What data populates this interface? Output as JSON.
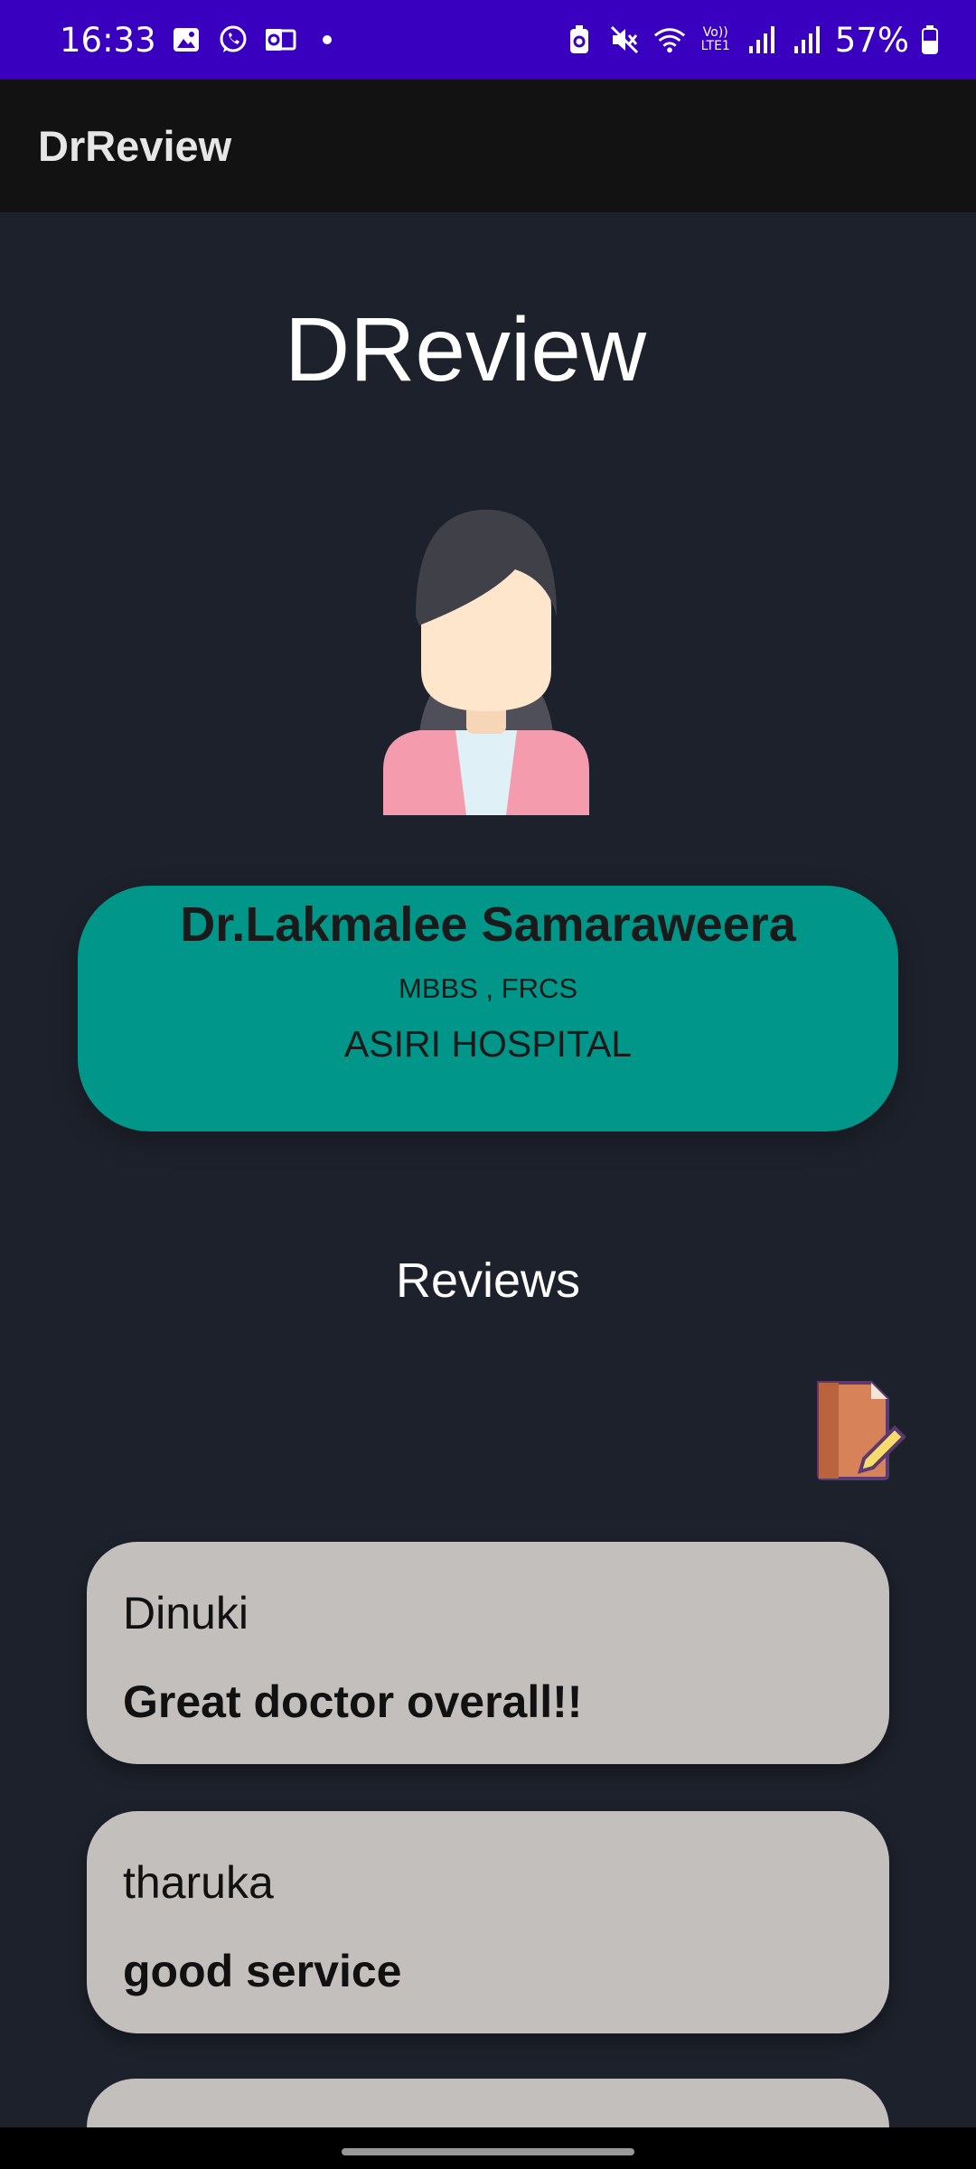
{
  "status_bar": {
    "time": "16:33",
    "battery": "57%",
    "icons_left": [
      "gallery-icon",
      "whatsapp-icon",
      "outlook-icon",
      "dot-icon"
    ],
    "icons_right": [
      "battery-saver-icon",
      "mute-icon",
      "wifi-icon",
      "volte-icon",
      "signal-icon",
      "signal-icon",
      "battery-icon"
    ],
    "volte_label": "Vo)) LTE1"
  },
  "app_bar": {
    "title": "DrReview"
  },
  "hero": {
    "title": "DReview"
  },
  "doctor": {
    "name": "Dr.Lakmalee Samaraweera",
    "qualifications": "MBBS , FRCS",
    "hospital": "ASIRI HOSPITAL"
  },
  "reviews": {
    "heading": "Reviews",
    "write_review_icon": "write-review-icon",
    "items": [
      {
        "author": "Dinuki",
        "text": "Great doctor overall!!"
      },
      {
        "author": "tharuka",
        "text": "good service"
      }
    ]
  },
  "colors": {
    "status_bar": "#3a00bf",
    "app_bar": "#121212",
    "background": "#1d212b",
    "doctor_card": "#00978a",
    "review_card": "#c3bfbd"
  }
}
